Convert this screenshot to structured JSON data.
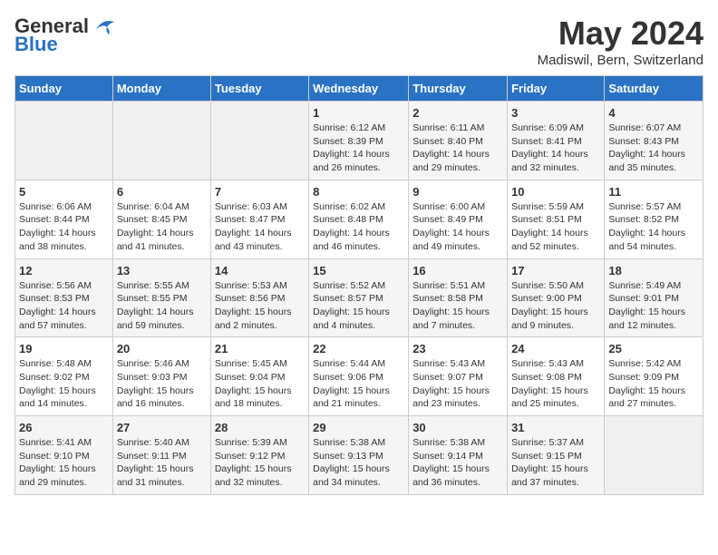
{
  "header": {
    "logo_line1": "General",
    "logo_line2": "Blue",
    "month_title": "May 2024",
    "location": "Madiswil, Bern, Switzerland"
  },
  "days_of_week": [
    "Sunday",
    "Monday",
    "Tuesday",
    "Wednesday",
    "Thursday",
    "Friday",
    "Saturday"
  ],
  "weeks": [
    [
      {
        "day": "",
        "info": ""
      },
      {
        "day": "",
        "info": ""
      },
      {
        "day": "",
        "info": ""
      },
      {
        "day": "1",
        "info": "Sunrise: 6:12 AM\nSunset: 8:39 PM\nDaylight: 14 hours\nand 26 minutes."
      },
      {
        "day": "2",
        "info": "Sunrise: 6:11 AM\nSunset: 8:40 PM\nDaylight: 14 hours\nand 29 minutes."
      },
      {
        "day": "3",
        "info": "Sunrise: 6:09 AM\nSunset: 8:41 PM\nDaylight: 14 hours\nand 32 minutes."
      },
      {
        "day": "4",
        "info": "Sunrise: 6:07 AM\nSunset: 8:43 PM\nDaylight: 14 hours\nand 35 minutes."
      }
    ],
    [
      {
        "day": "5",
        "info": "Sunrise: 6:06 AM\nSunset: 8:44 PM\nDaylight: 14 hours\nand 38 minutes."
      },
      {
        "day": "6",
        "info": "Sunrise: 6:04 AM\nSunset: 8:45 PM\nDaylight: 14 hours\nand 41 minutes."
      },
      {
        "day": "7",
        "info": "Sunrise: 6:03 AM\nSunset: 8:47 PM\nDaylight: 14 hours\nand 43 minutes."
      },
      {
        "day": "8",
        "info": "Sunrise: 6:02 AM\nSunset: 8:48 PM\nDaylight: 14 hours\nand 46 minutes."
      },
      {
        "day": "9",
        "info": "Sunrise: 6:00 AM\nSunset: 8:49 PM\nDaylight: 14 hours\nand 49 minutes."
      },
      {
        "day": "10",
        "info": "Sunrise: 5:59 AM\nSunset: 8:51 PM\nDaylight: 14 hours\nand 52 minutes."
      },
      {
        "day": "11",
        "info": "Sunrise: 5:57 AM\nSunset: 8:52 PM\nDaylight: 14 hours\nand 54 minutes."
      }
    ],
    [
      {
        "day": "12",
        "info": "Sunrise: 5:56 AM\nSunset: 8:53 PM\nDaylight: 14 hours\nand 57 minutes."
      },
      {
        "day": "13",
        "info": "Sunrise: 5:55 AM\nSunset: 8:55 PM\nDaylight: 14 hours\nand 59 minutes."
      },
      {
        "day": "14",
        "info": "Sunrise: 5:53 AM\nSunset: 8:56 PM\nDaylight: 15 hours\nand 2 minutes."
      },
      {
        "day": "15",
        "info": "Sunrise: 5:52 AM\nSunset: 8:57 PM\nDaylight: 15 hours\nand 4 minutes."
      },
      {
        "day": "16",
        "info": "Sunrise: 5:51 AM\nSunset: 8:58 PM\nDaylight: 15 hours\nand 7 minutes."
      },
      {
        "day": "17",
        "info": "Sunrise: 5:50 AM\nSunset: 9:00 PM\nDaylight: 15 hours\nand 9 minutes."
      },
      {
        "day": "18",
        "info": "Sunrise: 5:49 AM\nSunset: 9:01 PM\nDaylight: 15 hours\nand 12 minutes."
      }
    ],
    [
      {
        "day": "19",
        "info": "Sunrise: 5:48 AM\nSunset: 9:02 PM\nDaylight: 15 hours\nand 14 minutes."
      },
      {
        "day": "20",
        "info": "Sunrise: 5:46 AM\nSunset: 9:03 PM\nDaylight: 15 hours\nand 16 minutes."
      },
      {
        "day": "21",
        "info": "Sunrise: 5:45 AM\nSunset: 9:04 PM\nDaylight: 15 hours\nand 18 minutes."
      },
      {
        "day": "22",
        "info": "Sunrise: 5:44 AM\nSunset: 9:06 PM\nDaylight: 15 hours\nand 21 minutes."
      },
      {
        "day": "23",
        "info": "Sunrise: 5:43 AM\nSunset: 9:07 PM\nDaylight: 15 hours\nand 23 minutes."
      },
      {
        "day": "24",
        "info": "Sunrise: 5:43 AM\nSunset: 9:08 PM\nDaylight: 15 hours\nand 25 minutes."
      },
      {
        "day": "25",
        "info": "Sunrise: 5:42 AM\nSunset: 9:09 PM\nDaylight: 15 hours\nand 27 minutes."
      }
    ],
    [
      {
        "day": "26",
        "info": "Sunrise: 5:41 AM\nSunset: 9:10 PM\nDaylight: 15 hours\nand 29 minutes."
      },
      {
        "day": "27",
        "info": "Sunrise: 5:40 AM\nSunset: 9:11 PM\nDaylight: 15 hours\nand 31 minutes."
      },
      {
        "day": "28",
        "info": "Sunrise: 5:39 AM\nSunset: 9:12 PM\nDaylight: 15 hours\nand 32 minutes."
      },
      {
        "day": "29",
        "info": "Sunrise: 5:38 AM\nSunset: 9:13 PM\nDaylight: 15 hours\nand 34 minutes."
      },
      {
        "day": "30",
        "info": "Sunrise: 5:38 AM\nSunset: 9:14 PM\nDaylight: 15 hours\nand 36 minutes."
      },
      {
        "day": "31",
        "info": "Sunrise: 5:37 AM\nSunset: 9:15 PM\nDaylight: 15 hours\nand 37 minutes."
      },
      {
        "day": "",
        "info": ""
      }
    ]
  ]
}
